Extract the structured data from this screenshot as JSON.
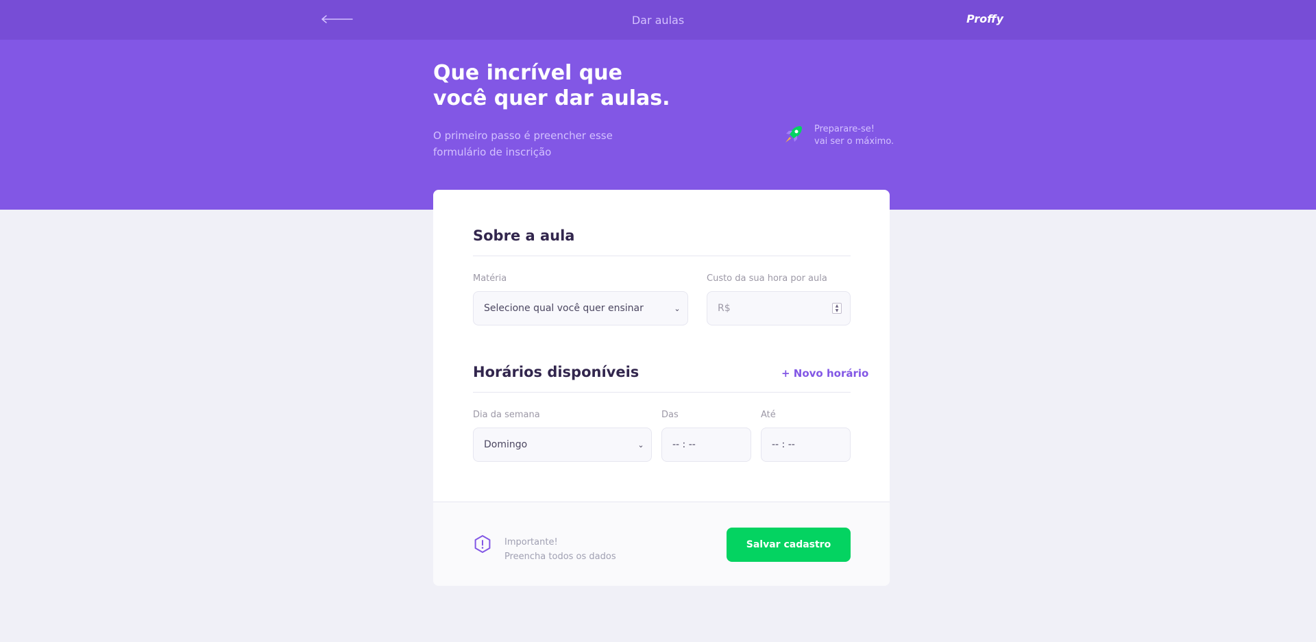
{
  "header": {
    "title": "Dar aulas",
    "brand": "Proffy",
    "back_icon": "arrow-left-icon"
  },
  "hero": {
    "title_line1": "Que incrível que",
    "title_line2": "você quer dar aulas.",
    "description_line1": "O primeiro passo é preencher esse",
    "description_line2": "formulário de inscrição",
    "tip_icon": "rocket-icon",
    "tip_line1": "Preparare-se!",
    "tip_line2": "vai ser o máximo."
  },
  "about": {
    "title": "Sobre a aula",
    "subject_label": "Matéria",
    "subject_value": "Selecione qual você quer ensinar",
    "cost_label": "Custo da sua hora por aula",
    "cost_placeholder": "R$"
  },
  "schedule": {
    "title": "Horários disponíveis",
    "new_label": "+ Novo horário",
    "weekday_label": "Dia da semana",
    "weekday_value": "Domingo",
    "from_label": "Das",
    "from_value": "-- : --",
    "to_label": "Até",
    "to_value": "-- : --"
  },
  "footer": {
    "warning_icon": "warning-icon",
    "warning_title": "Importante!",
    "warning_text": "Preencha todos os dados",
    "save_label": "Salvar cadastro"
  },
  "colors": {
    "primary": "#8257E5",
    "primary_dark": "#774DD6",
    "secondary": "#04D361",
    "background": "#F0F0F7",
    "title": "#32264D"
  }
}
